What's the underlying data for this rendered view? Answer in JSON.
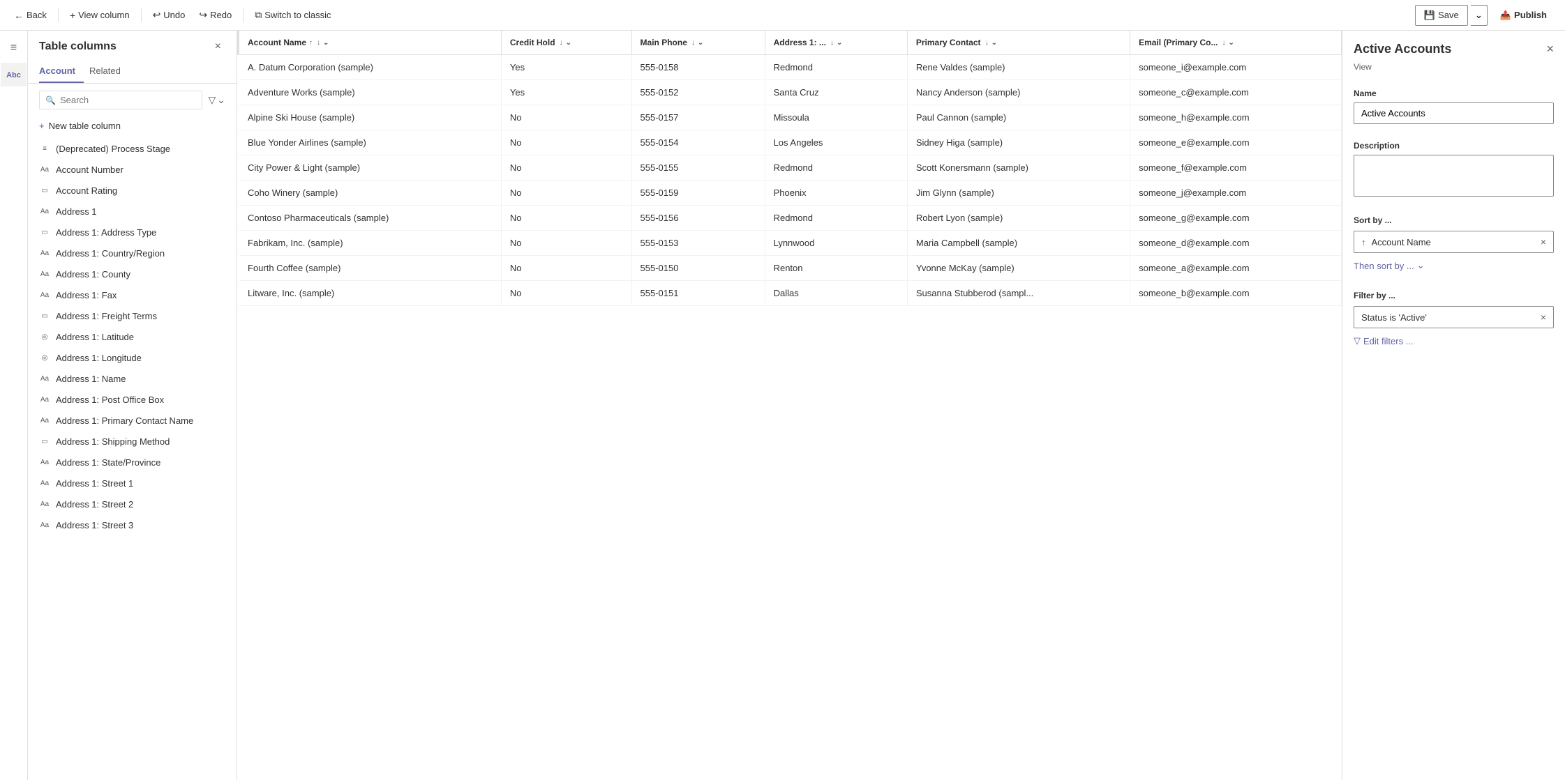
{
  "toolbar": {
    "back_label": "Back",
    "view_column_label": "View column",
    "undo_label": "Undo",
    "redo_label": "Redo",
    "switch_label": "Switch to classic",
    "save_label": "Save",
    "publish_label": "Publish"
  },
  "sidebar": {
    "title": "Table columns",
    "close_label": "×",
    "tabs": [
      {
        "id": "account",
        "label": "Account",
        "active": true
      },
      {
        "id": "related",
        "label": "Related",
        "active": false
      }
    ],
    "search_placeholder": "Search",
    "new_column_label": "New table column",
    "items": [
      {
        "id": "process-stage",
        "label": "(Deprecated) Process Stage",
        "icon": "list"
      },
      {
        "id": "account-number",
        "label": "Account Number",
        "icon": "text"
      },
      {
        "id": "account-rating",
        "label": "Account Rating",
        "icon": "dropdown"
      },
      {
        "id": "address1",
        "label": "Address 1",
        "icon": "text"
      },
      {
        "id": "address1-type",
        "label": "Address 1: Address Type",
        "icon": "dropdown"
      },
      {
        "id": "address1-country",
        "label": "Address 1: Country/Region",
        "icon": "text"
      },
      {
        "id": "address1-county",
        "label": "Address 1: County",
        "icon": "text"
      },
      {
        "id": "address1-fax",
        "label": "Address 1: Fax",
        "icon": "text"
      },
      {
        "id": "address1-freight",
        "label": "Address 1: Freight Terms",
        "icon": "dropdown"
      },
      {
        "id": "address1-latitude",
        "label": "Address 1: Latitude",
        "icon": "globe"
      },
      {
        "id": "address1-longitude",
        "label": "Address 1: Longitude",
        "icon": "globe"
      },
      {
        "id": "address1-name",
        "label": "Address 1: Name",
        "icon": "text"
      },
      {
        "id": "address1-pobox",
        "label": "Address 1: Post Office Box",
        "icon": "text"
      },
      {
        "id": "address1-primary-contact",
        "label": "Address 1: Primary Contact Name",
        "icon": "text"
      },
      {
        "id": "address1-shipping",
        "label": "Address 1: Shipping Method",
        "icon": "dropdown"
      },
      {
        "id": "address1-state",
        "label": "Address 1: State/Province",
        "icon": "text"
      },
      {
        "id": "address1-street1",
        "label": "Address 1: Street 1",
        "icon": "text"
      },
      {
        "id": "address1-street2",
        "label": "Address 1: Street 2",
        "icon": "text"
      },
      {
        "id": "address1-street3",
        "label": "Address 1: Street 3",
        "icon": "text"
      }
    ]
  },
  "table": {
    "columns": [
      {
        "id": "account-name",
        "label": "Account Name",
        "sortable": true,
        "sort": "asc",
        "dropdown": true
      },
      {
        "id": "credit-hold",
        "label": "Credit Hold",
        "sortable": false,
        "dropdown": true
      },
      {
        "id": "main-phone",
        "label": "Main Phone",
        "sortable": false,
        "dropdown": true
      },
      {
        "id": "address1",
        "label": "Address 1: ...",
        "sortable": false,
        "dropdown": true
      },
      {
        "id": "primary-contact",
        "label": "Primary Contact",
        "sortable": false,
        "dropdown": true
      },
      {
        "id": "email",
        "label": "Email (Primary Co...",
        "sortable": false,
        "dropdown": true
      }
    ],
    "rows": [
      {
        "account_name": "A. Datum Corporation (sample)",
        "credit_hold": "Yes",
        "main_phone": "555-0158",
        "address1": "Redmond",
        "primary_contact": "Rene Valdes (sample)",
        "email": "someone_i@example.com"
      },
      {
        "account_name": "Adventure Works (sample)",
        "credit_hold": "Yes",
        "main_phone": "555-0152",
        "address1": "Santa Cruz",
        "primary_contact": "Nancy Anderson (sample)",
        "email": "someone_c@example.com"
      },
      {
        "account_name": "Alpine Ski House (sample)",
        "credit_hold": "No",
        "main_phone": "555-0157",
        "address1": "Missoula",
        "primary_contact": "Paul Cannon (sample)",
        "email": "someone_h@example.com"
      },
      {
        "account_name": "Blue Yonder Airlines (sample)",
        "credit_hold": "No",
        "main_phone": "555-0154",
        "address1": "Los Angeles",
        "primary_contact": "Sidney Higa (sample)",
        "email": "someone_e@example.com"
      },
      {
        "account_name": "City Power & Light (sample)",
        "credit_hold": "No",
        "main_phone": "555-0155",
        "address1": "Redmond",
        "primary_contact": "Scott Konersmann (sample)",
        "email": "someone_f@example.com"
      },
      {
        "account_name": "Coho Winery (sample)",
        "credit_hold": "No",
        "main_phone": "555-0159",
        "address1": "Phoenix",
        "primary_contact": "Jim Glynn (sample)",
        "email": "someone_j@example.com"
      },
      {
        "account_name": "Contoso Pharmaceuticals (sample)",
        "credit_hold": "No",
        "main_phone": "555-0156",
        "address1": "Redmond",
        "primary_contact": "Robert Lyon (sample)",
        "email": "someone_g@example.com"
      },
      {
        "account_name": "Fabrikam, Inc. (sample)",
        "credit_hold": "No",
        "main_phone": "555-0153",
        "address1": "Lynnwood",
        "primary_contact": "Maria Campbell (sample)",
        "email": "someone_d@example.com"
      },
      {
        "account_name": "Fourth Coffee (sample)",
        "credit_hold": "No",
        "main_phone": "555-0150",
        "address1": "Renton",
        "primary_contact": "Yvonne McKay (sample)",
        "email": "someone_a@example.com"
      },
      {
        "account_name": "Litware, Inc. (sample)",
        "credit_hold": "No",
        "main_phone": "555-0151",
        "address1": "Dallas",
        "primary_contact": "Susanna Stubberod (sampl...",
        "email": "someone_b@example.com"
      }
    ]
  },
  "right_panel": {
    "title": "Active Accounts",
    "subtitle": "View",
    "close_label": "×",
    "name_label": "Name",
    "name_value": "Active Accounts",
    "description_label": "Description",
    "description_placeholder": "",
    "sort_label": "Sort by ...",
    "sort_item": {
      "icon": "↑",
      "value": "Account Name",
      "remove": "×"
    },
    "then_sort_label": "Then sort by ...",
    "filter_label": "Filter by ...",
    "filter_item": {
      "value": "Status is 'Active'",
      "remove": "×"
    },
    "edit_filters_label": "Edit filters ..."
  },
  "icons": {
    "back": "←",
    "view_column": "+",
    "undo": "↩",
    "redo": "↪",
    "switch": "⧉",
    "save": "💾",
    "publish": "📤",
    "hamburger": "≡",
    "abc": "Abc",
    "search": "🔍",
    "filter": "▽",
    "chevron_down": "⌄",
    "plus": "+",
    "list_icon": "≡",
    "text_icon": "Aa",
    "dropdown_icon": "▭",
    "globe_icon": "◎",
    "sort_asc": "↑",
    "sort_desc": "↓",
    "x": "×"
  }
}
